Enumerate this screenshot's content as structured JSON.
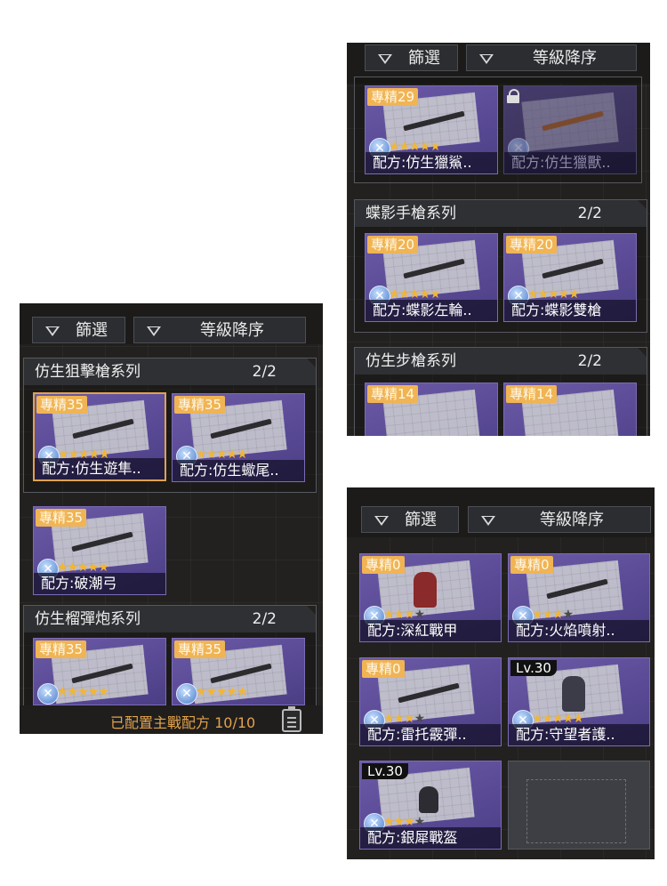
{
  "ui": {
    "filter_label": "篩選",
    "sort_label": "等級降序"
  },
  "panel_left": {
    "sections": [
      {
        "title": "仿生狙擊槍系列",
        "count": "2/2"
      },
      {
        "title": "仿生榴彈炮系列",
        "count": "2/2"
      }
    ],
    "cards": [
      {
        "badge": "專精35",
        "name": "配方:仿生遊隼..",
        "stars": 5,
        "selected": true
      },
      {
        "badge": "專精35",
        "name": "配方:仿生蠍尾..",
        "stars": 5
      },
      {
        "badge": "專精35",
        "name": "配方:破潮弓",
        "stars": 5
      },
      {
        "badge": "專精35",
        "name": "",
        "stars": 5
      },
      {
        "badge": "專精35",
        "name": "",
        "stars": 5
      }
    ],
    "status_text": "已配置主戰配方 10/10"
  },
  "panel_top_right": {
    "sections": [
      {
        "title": "蝶影手槍系列",
        "count": "2/2"
      },
      {
        "title": "仿生步槍系列",
        "count": "2/2"
      }
    ],
    "cards": [
      {
        "badge": "專精29",
        "name": "配方:仿生獵鯊..",
        "stars": 5
      },
      {
        "badge": "",
        "name": "配方:仿生獵獸..",
        "stars": 0,
        "locked": true
      },
      {
        "badge": "專精20",
        "name": "配方:蝶影左輪..",
        "stars": 5
      },
      {
        "badge": "專精20",
        "name": "配方:蝶影雙槍",
        "stars": 5
      },
      {
        "badge": "專精14",
        "name": "",
        "stars": 0
      },
      {
        "badge": "專精14",
        "name": "",
        "stars": 0
      }
    ]
  },
  "panel_bottom_right": {
    "cards": [
      {
        "badge": "專精0",
        "name": "配方:深紅戰甲",
        "stars": 3
      },
      {
        "badge": "專精0",
        "name": "配方:火焰噴射..",
        "stars": 3
      },
      {
        "badge": "專精0",
        "name": "配方:雷托霰彈..",
        "stars": 3
      },
      {
        "level": "Lv.30",
        "name": "配方:守望者護..",
        "stars": 5
      },
      {
        "level": "Lv.30",
        "name": "配方:銀犀戰盔",
        "stars": 3
      }
    ]
  },
  "colors": {
    "accent": "#f0b454",
    "card": "#5a4a96",
    "panel": "#23211f"
  }
}
